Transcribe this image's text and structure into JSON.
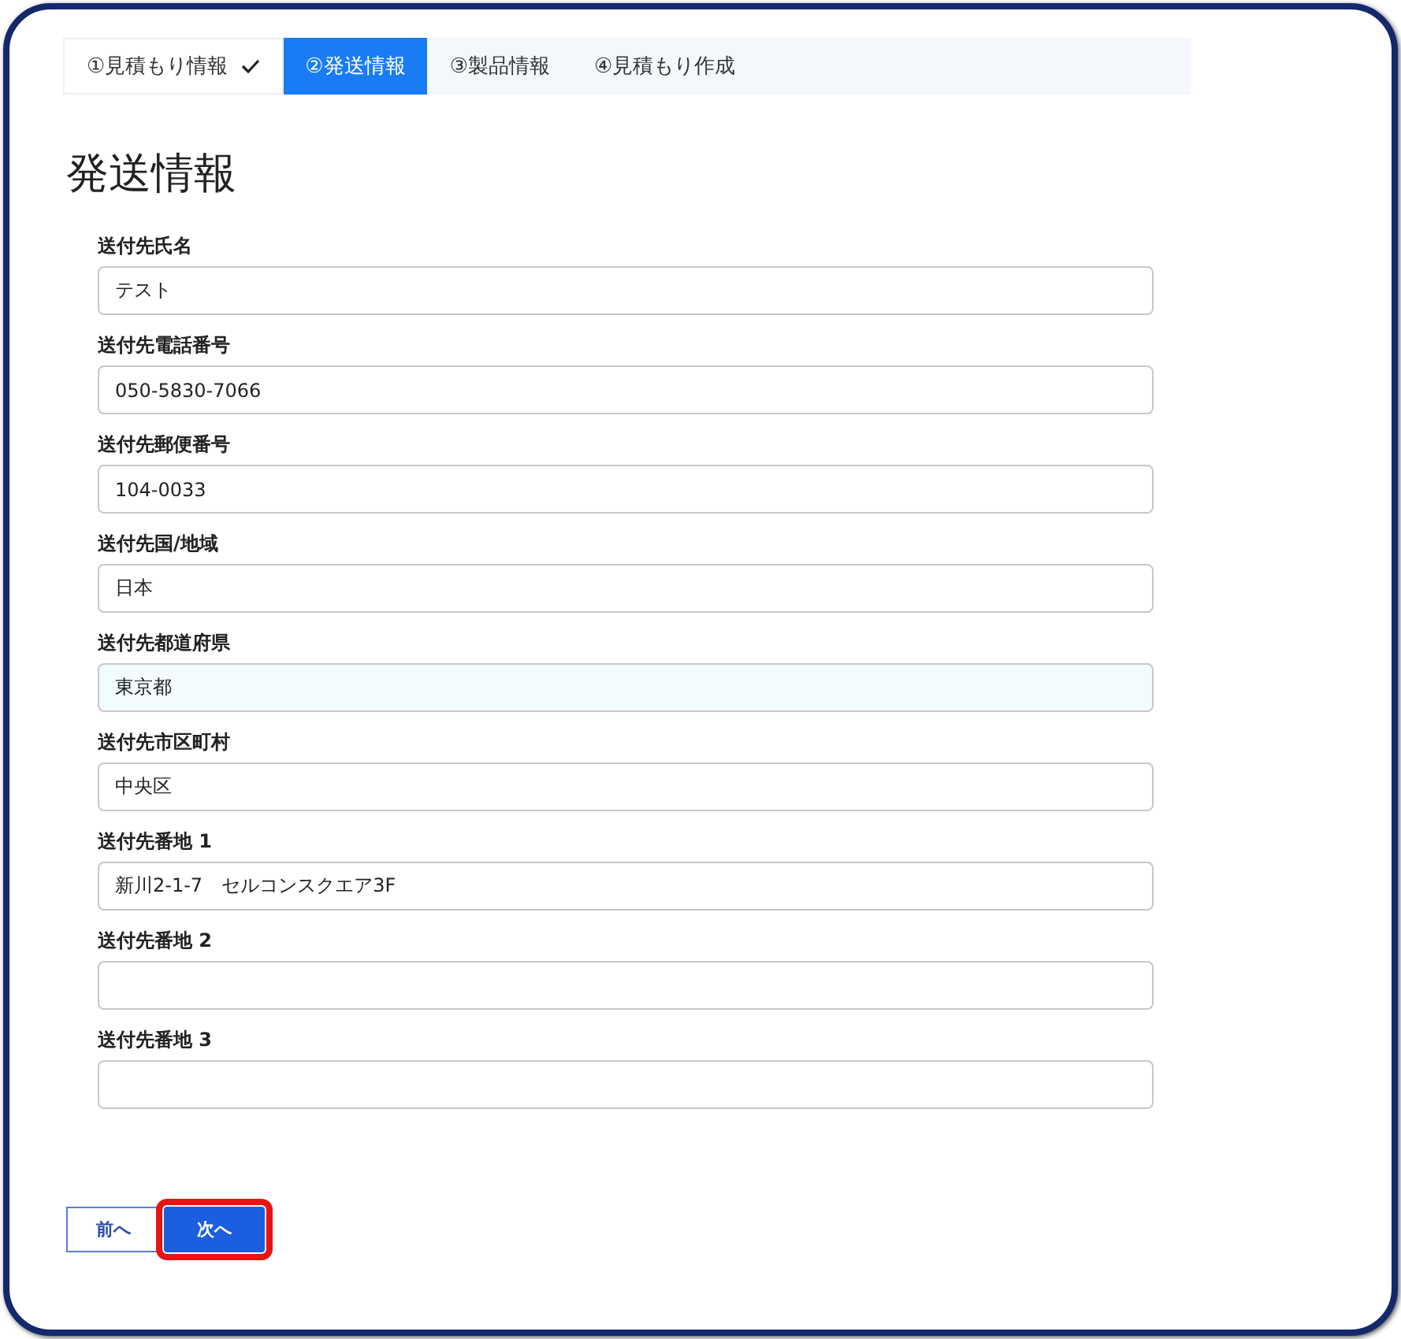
{
  "steps": [
    {
      "label": "①見積もり情報",
      "selected": false,
      "completed": true
    },
    {
      "label": "②発送情報",
      "selected": true,
      "completed": false
    },
    {
      "label": "③製品情報",
      "selected": false,
      "completed": false
    },
    {
      "label": "④見積もり作成",
      "selected": false,
      "completed": false
    }
  ],
  "heading": "発送情報",
  "fields": [
    {
      "label": "送付先氏名",
      "value": "テスト",
      "autofilled": false
    },
    {
      "label": "送付先電話番号",
      "value": "050-5830-7066",
      "autofilled": false
    },
    {
      "label": "送付先郵便番号",
      "value": "104-0033",
      "autofilled": false
    },
    {
      "label": "送付先国/地域",
      "value": "日本",
      "autofilled": false
    },
    {
      "label": "送付先都道府県",
      "value": "東京都",
      "autofilled": true
    },
    {
      "label": "送付先市区町村",
      "value": "中央区",
      "autofilled": false
    },
    {
      "label": "送付先番地 1",
      "value": "新川2-1-7　セルコンスクエア3F",
      "autofilled": false
    },
    {
      "label": "送付先番地 2",
      "autofilled": false
    },
    {
      "label": "送付先番地 3",
      "autofilled": false
    }
  ],
  "buttons": [
    {
      "label": "前へ",
      "kind": "secondary",
      "highlighted": false
    },
    {
      "label": "次へ",
      "kind": "primary",
      "highlighted": true
    }
  ]
}
